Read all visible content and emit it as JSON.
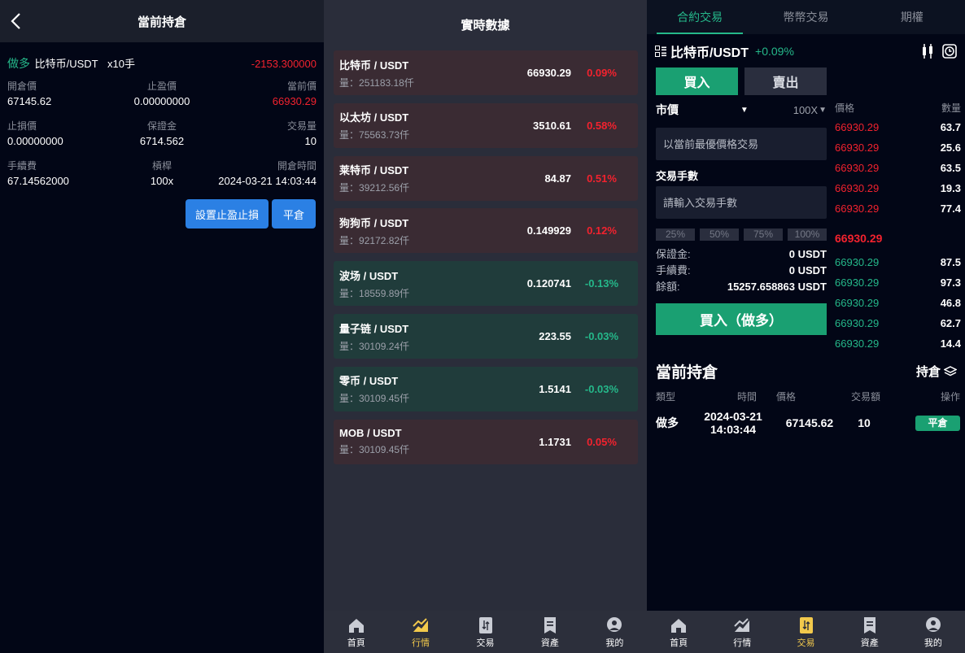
{
  "left_panel": {
    "title": "當前持倉",
    "position": {
      "direction": "做多",
      "pair": "比特币/USDT",
      "lots": "x10手",
      "pnl": "-2153.300000"
    },
    "fields": [
      {
        "label": "開倉價",
        "value": "67145.62"
      },
      {
        "label": "止盈價",
        "value": "0.00000000"
      },
      {
        "label": "當前價",
        "value": "66930.29"
      },
      {
        "label": "止損價",
        "value": "0.00000000"
      },
      {
        "label": "保證金",
        "value": "6714.562"
      },
      {
        "label": "交易量",
        "value": "10"
      },
      {
        "label": "手續費",
        "value": "67.14562000"
      },
      {
        "label": "槓桿",
        "value": "100x"
      },
      {
        "label": "開倉時間",
        "value": "2024-03-21 14:03:44"
      }
    ],
    "buttons": {
      "set_tp_sl": "設置止盈止損",
      "close": "平倉"
    }
  },
  "market_panel": {
    "title": "實時數據",
    "vol_prefix": "量：",
    "coins": [
      {
        "name": "比特币 / USDT",
        "vol": "251183.18仟",
        "price": "66930.29",
        "change": "0.09%",
        "dir": "up"
      },
      {
        "name": "以太坊 / USDT",
        "vol": "75563.73仟",
        "price": "3510.61",
        "change": "0.58%",
        "dir": "up"
      },
      {
        "name": "莱特币 / USDT",
        "vol": "39212.56仟",
        "price": "84.87",
        "change": "0.51%",
        "dir": "up"
      },
      {
        "name": "狗狗币 / USDT",
        "vol": "92172.82仟",
        "price": "0.149929",
        "change": "0.12%",
        "dir": "up"
      },
      {
        "name": "波场 / USDT",
        "vol": "18559.89仟",
        "price": "0.120741",
        "change": "-0.13%",
        "dir": "dn"
      },
      {
        "name": "量子链 / USDT",
        "vol": "30109.24仟",
        "price": "223.55",
        "change": "-0.03%",
        "dir": "dn"
      },
      {
        "name": "零币 / USDT",
        "vol": "30109.45仟",
        "price": "1.5141",
        "change": "-0.03%",
        "dir": "dn"
      },
      {
        "name": "MOB / USDT",
        "vol": "30109.45仟",
        "price": "1.1731",
        "change": "0.05%",
        "dir": "up"
      }
    ],
    "nav": [
      {
        "label": "首頁",
        "icon": "home-icon"
      },
      {
        "label": "行情",
        "icon": "chart-icon"
      },
      {
        "label": "交易",
        "icon": "trade-icon"
      },
      {
        "label": "資產",
        "icon": "asset-icon"
      },
      {
        "label": "我的",
        "icon": "profile-icon"
      }
    ]
  },
  "trade_panel": {
    "tabs": [
      "合約交易",
      "幣幣交易",
      "期權"
    ],
    "pair": "比特币/USDT",
    "pair_change": "+0.09%",
    "buy_label": "買入",
    "sell_label": "賣出",
    "order_type": "市價",
    "leverage": "100X",
    "price_placeholder": "以當前最優價格交易",
    "qty_label": "交易手數",
    "qty_placeholder": "請輸入交易手數",
    "percents": [
      "25%",
      "50%",
      "75%",
      "100%"
    ],
    "margin_label": "保證金:",
    "margin_value": "0 USDT",
    "fee_label": "手續費:",
    "fee_value": "0 USDT",
    "balance_label": "餘額:",
    "balance_value": "15257.658863 USDT",
    "submit_label": "買入（做多）",
    "book_head": {
      "price": "價格",
      "qty": "數量"
    },
    "asks": [
      {
        "price": "66930.29",
        "qty": "63.7"
      },
      {
        "price": "66930.29",
        "qty": "25.6"
      },
      {
        "price": "66930.29",
        "qty": "63.5"
      },
      {
        "price": "66930.29",
        "qty": "19.3"
      },
      {
        "price": "66930.29",
        "qty": "77.4"
      }
    ],
    "mid_price": "66930.29",
    "bids": [
      {
        "price": "66930.29",
        "qty": "87.5"
      },
      {
        "price": "66930.29",
        "qty": "97.3"
      },
      {
        "price": "66930.29",
        "qty": "46.8"
      },
      {
        "price": "66930.29",
        "qty": "62.7"
      },
      {
        "price": "66930.29",
        "qty": "14.4"
      }
    ],
    "positions_title": "當前持倉",
    "positions_link": "持倉",
    "pos_head": [
      "類型",
      "時間",
      "價格",
      "交易額",
      "操作"
    ],
    "pos_row": {
      "type": "做多",
      "date": "2024-03-21",
      "time": "14:03:44",
      "price": "67145.62",
      "amount": "10",
      "action": "平倉"
    },
    "nav": [
      {
        "label": "首頁",
        "icon": "home-icon"
      },
      {
        "label": "行情",
        "icon": "chart-icon"
      },
      {
        "label": "交易",
        "icon": "trade-icon"
      },
      {
        "label": "資產",
        "icon": "asset-icon"
      },
      {
        "label": "我的",
        "icon": "profile-icon"
      }
    ]
  },
  "colors": {
    "up": "#f3222e",
    "down": "#25b88a",
    "accent": "#f2c94c",
    "button_blue": "#2b80e4"
  }
}
